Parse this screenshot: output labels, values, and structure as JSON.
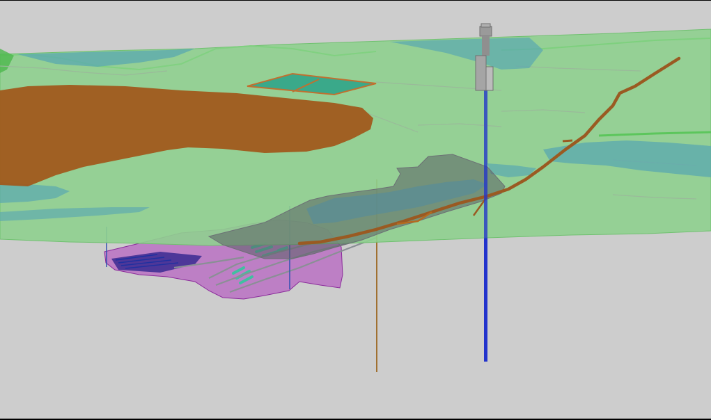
{
  "scene": {
    "background_color": "#cdcdcd",
    "colors": {
      "terrain": "#8fd08f",
      "terrain_edge": "#6fc06f",
      "water": "#5aa8b0",
      "tailings": "#a05a1c",
      "pond": "#3aa98a",
      "pond_frame": "#c07030",
      "decline": "#9a5a22",
      "shaft": "#2233cc",
      "headframe": "#9a9a9a",
      "workings": "#555a60",
      "stopes": "#b040c0",
      "drill_hole_brown": "#a07030",
      "drill_hole_blue": "#3050b0",
      "drives_cyan": "#40c0a0"
    },
    "objects": [
      "terrain-surface",
      "tailings-storage",
      "settling-ponds",
      "lake",
      "decline-ramp",
      "vertical-shaft",
      "headframe",
      "underground-workings",
      "stope-envelope",
      "drill-holes"
    ]
  }
}
